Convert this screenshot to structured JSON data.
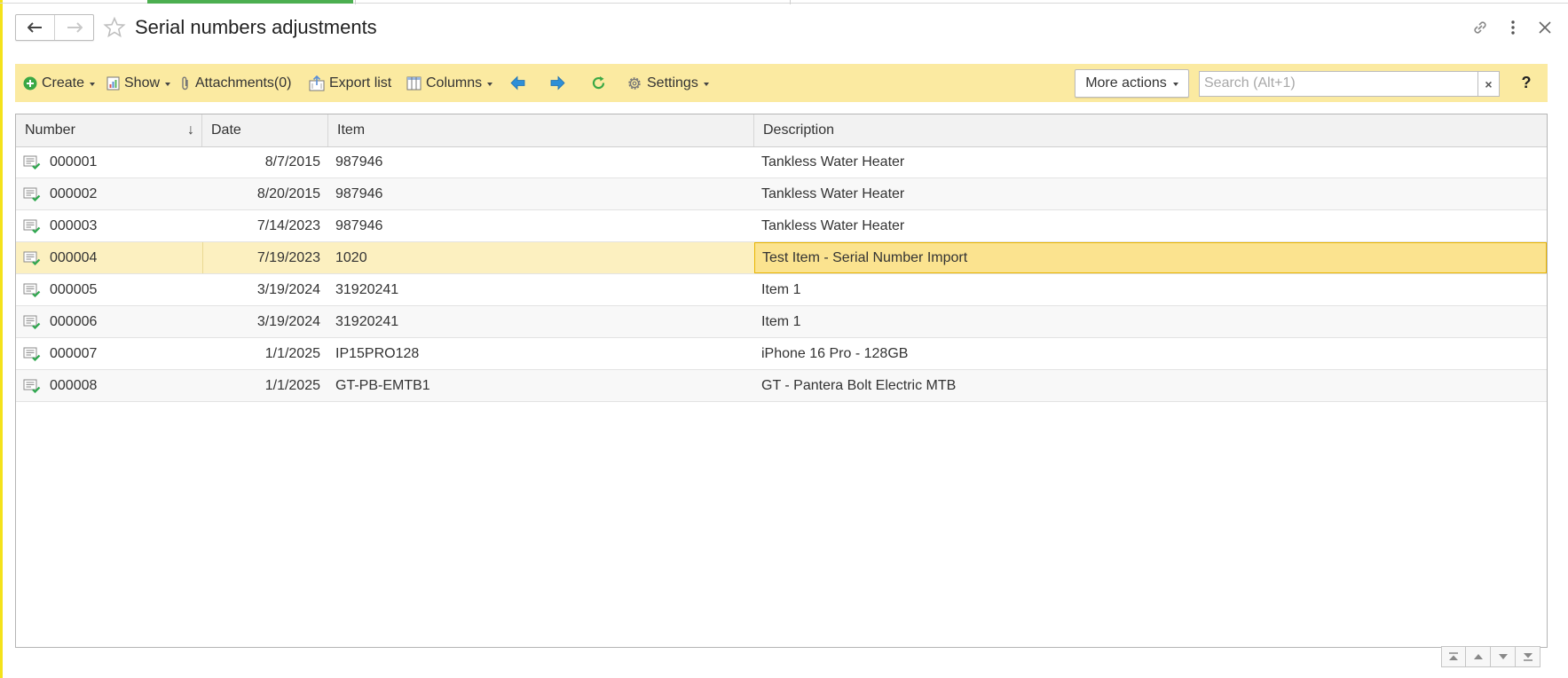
{
  "header": {
    "title": "Serial numbers adjustments"
  },
  "toolbar": {
    "create": "Create",
    "show": "Show",
    "attachments": "Attachments(0)",
    "export": "Export list",
    "columns": "Columns",
    "settings": "Settings",
    "more_actions": "More actions",
    "search_placeholder": "Search (Alt+1)",
    "search_clear": "×",
    "help": "?"
  },
  "table": {
    "columns": [
      "Number",
      "Date",
      "Item",
      "Description"
    ],
    "sort_indicator": "↓",
    "rows": [
      {
        "number": "000001",
        "date": "8/7/2015",
        "item": "987946",
        "description": "Tankless Water Heater"
      },
      {
        "number": "000002",
        "date": "8/20/2015",
        "item": "987946",
        "description": "Tankless Water Heater"
      },
      {
        "number": "000003",
        "date": "7/14/2023",
        "item": "987946",
        "description": "Tankless Water Heater"
      },
      {
        "number": "000004",
        "date": "7/19/2023",
        "item": "1020",
        "description": "Test Item - Serial Number Import"
      },
      {
        "number": "000005",
        "date": "3/19/2024",
        "item": "31920241",
        "description": "Item 1"
      },
      {
        "number": "000006",
        "date": "3/19/2024",
        "item": "31920241",
        "description": "Item 1"
      },
      {
        "number": "000007",
        "date": "1/1/2025",
        "item": "IP15PRO128",
        "description": "iPhone 16 Pro - 128GB"
      },
      {
        "number": "000008",
        "date": "1/1/2025",
        "item": "GT-PB-EMTB1",
        "description": "GT - Pantera Bolt Electric MTB"
      }
    ],
    "selected_row": "000004"
  },
  "colors": {
    "toolbar_bg": "#fbeaa1",
    "selected_row": "#fbf2c8",
    "selected_cell": "#fbe38f",
    "accent_green": "#4caf50",
    "nav_arrow_blue": "#2e8fd6"
  },
  "icons": [
    "back-arrow-icon",
    "forward-arrow-icon",
    "star-icon",
    "link-icon",
    "more-vertical-icon",
    "close-icon",
    "plus-circle-icon",
    "report-icon",
    "paperclip-icon",
    "export-icon",
    "columns-icon",
    "prev-arrow-icon",
    "next-arrow-icon",
    "refresh-icon",
    "gear-icon",
    "document-posted-icon",
    "scroll-top-icon",
    "scroll-up-icon",
    "scroll-down-icon",
    "scroll-bottom-icon"
  ]
}
